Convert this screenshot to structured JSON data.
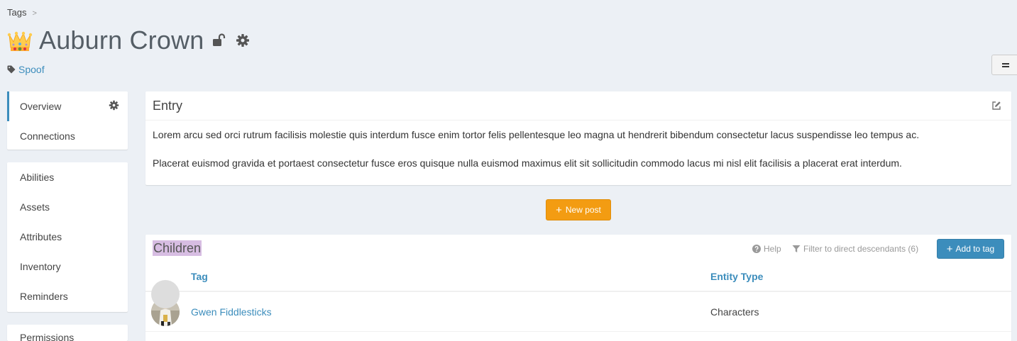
{
  "breadcrumb": {
    "root": "Tags",
    "separator": ">"
  },
  "header": {
    "title": "Auburn Crown",
    "tag_link": "Spoof",
    "icons": [
      "crown-icon",
      "unlock-icon",
      "gear-icon",
      "tag-icon"
    ]
  },
  "sidebar": {
    "group1": [
      {
        "label": "Overview",
        "active": true
      },
      {
        "label": "Connections"
      }
    ],
    "group2": [
      {
        "label": "Abilities"
      },
      {
        "label": "Assets"
      },
      {
        "label": "Attributes"
      },
      {
        "label": "Inventory"
      },
      {
        "label": "Reminders"
      }
    ],
    "group3": [
      {
        "label": "Permissions"
      }
    ]
  },
  "entry": {
    "title": "Entry",
    "paragraphs": [
      "Lorem arcu sed orci rutrum facilisis molestie quis interdum fusce enim tortor felis pellentesque leo magna ut hendrerit bibendum consectetur lacus suspendisse leo tempus ac.",
      "Placerat euismod gravida et portaest consectetur fusce eros quisque nulla euismod maximus elit sit sollicitudin commodo lacus mi nisl elit facilisis a placerat erat interdum."
    ]
  },
  "new_post": {
    "plus": "+",
    "label": "New post"
  },
  "children": {
    "title": "Children",
    "help": "Help",
    "filter": "Filter to direct descendants (6)",
    "add_button": {
      "plus": "+",
      "label": "Add to tag"
    },
    "columns": [
      "Tag",
      "Entity Type"
    ],
    "rows": [
      {
        "name": "Gwen Fiddlesticks",
        "type": "Characters"
      }
    ]
  },
  "colors": {
    "background": "#ecf0f5",
    "link": "#3c8dbc",
    "primary_button": "#3c8dbc",
    "warning_button": "#f39c12",
    "highlight": "#d7bde2"
  }
}
